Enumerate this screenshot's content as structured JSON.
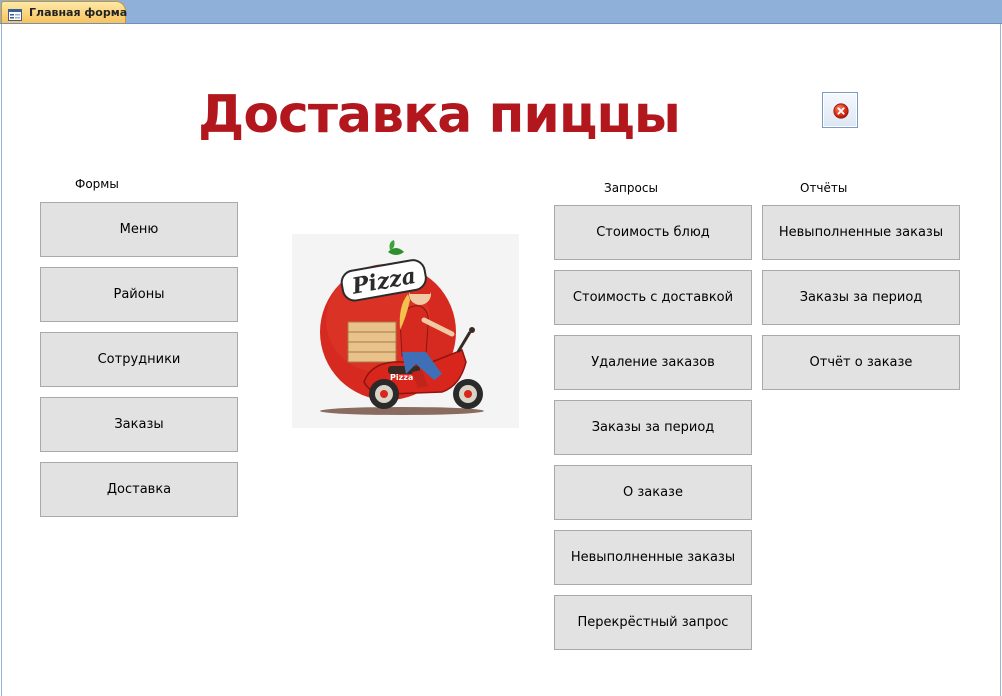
{
  "window": {
    "tab_label": "Главная форма"
  },
  "form": {
    "title": "Доставка пиццы",
    "close_icon": "close-circle-icon"
  },
  "forms_section": {
    "label": "Формы",
    "buttons": [
      "Меню",
      "Районы",
      "Сотрудники",
      "Заказы",
      "Доставка"
    ]
  },
  "queries_section": {
    "label": "Запросы",
    "buttons": [
      "Стоимость блюд",
      "Стоимость с доставкой",
      "Удаление заказов",
      "Заказы за период",
      "О заказе",
      "Невыполненные заказы",
      "Перекрёстный запрос"
    ]
  },
  "reports_section": {
    "label": "Отчёты",
    "buttons": [
      "Невыполненные заказы",
      "Заказы за период",
      "Отчёт о заказе"
    ]
  },
  "picture": {
    "logo_text": "Pizza",
    "box_text": "Pizza"
  },
  "colors": {
    "title": "#b3171e",
    "button_bg": "#e2e2e2",
    "tab_bg": "#f9c25b",
    "tabstrip_bg": "#8fb0d9"
  }
}
